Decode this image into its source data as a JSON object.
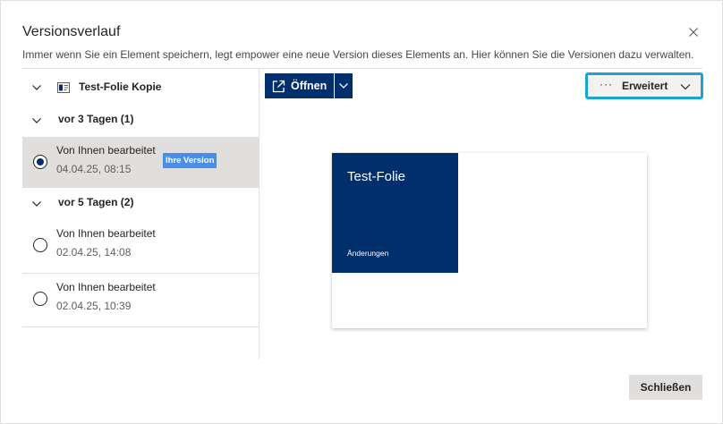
{
  "dialog": {
    "title": "Versionsverlauf",
    "description": "Immer wenn Sie ein Element speichern, legt empower eine neue Version dieses Elements an. Hier können Sie die Versionen dazu verwalten.",
    "close_icon": "close-icon"
  },
  "file": {
    "name": "Test-Folie Kopie",
    "icon": "slide-file-icon"
  },
  "groups": [
    {
      "label": "vor 3 Tagen (1)",
      "versions": [
        {
          "author": "Von Ihnen bearbeitet",
          "date": "04.04.25, 08:15",
          "badge": "Ihre Version",
          "selected": true
        }
      ]
    },
    {
      "label": "vor 5 Tagen (2)",
      "versions": [
        {
          "author": "Von Ihnen bearbeitet",
          "date": "02.04.25, 14:08",
          "selected": false
        },
        {
          "author": "Von Ihnen bearbeitet",
          "date": "02.04.25, 10:39",
          "selected": false
        }
      ]
    }
  ],
  "toolbar": {
    "open_label": "Öffnen",
    "advanced_dots": "···",
    "advanced_label": "Erweitert"
  },
  "preview": {
    "slide_title": "Test-Folie",
    "slide_subtitle": "Änderungen"
  },
  "footer": {
    "close_label": "Schließen"
  },
  "colors": {
    "primary": "#002f6c",
    "badge": "#4a8fe7",
    "focus_ring": "#19a3d8",
    "selected_row": "#e1dfdd"
  }
}
